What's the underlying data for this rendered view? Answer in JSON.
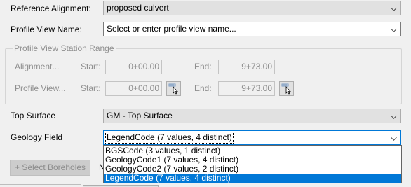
{
  "reference_alignment": {
    "label": "Reference Alignment:",
    "value": "proposed culvert"
  },
  "profile_view_name": {
    "label": "Profile View Name:",
    "placeholder": "Select or enter profile view name..."
  },
  "station_range": {
    "title": "Profile View Station Range",
    "alignment_label": "Alignment...",
    "profile_view_label": "Profile View...",
    "start_label": "Start:",
    "end_label": "End:",
    "alignment_start": "0+00.00",
    "alignment_end": "9+73.00",
    "profile_start": "0+00.00",
    "profile_end": "9+73.00"
  },
  "top_surface": {
    "label": "Top Surface",
    "value": "GM - Top Surface"
  },
  "geology_field": {
    "label": "Geology Field",
    "value": "LegendCode (7 values, 4 distinct)",
    "options": [
      "BGSCode (3 values, 1 distinct)",
      "GeologyCode1 (7 values, 4 distinct)",
      "GeologyCode2 (7 values, 2 distinct)",
      "LegendCode (7 values, 4 distinct)"
    ],
    "selected_index": 3
  },
  "select_boreholes_button": "+ Select Boreholes",
  "partial_label": "N",
  "colors": {
    "highlight": "#0078d7",
    "disabled_text": "#8f8f8f"
  },
  "icons": [
    "chevron-down-icon",
    "pick-from-drawing-icon"
  ]
}
